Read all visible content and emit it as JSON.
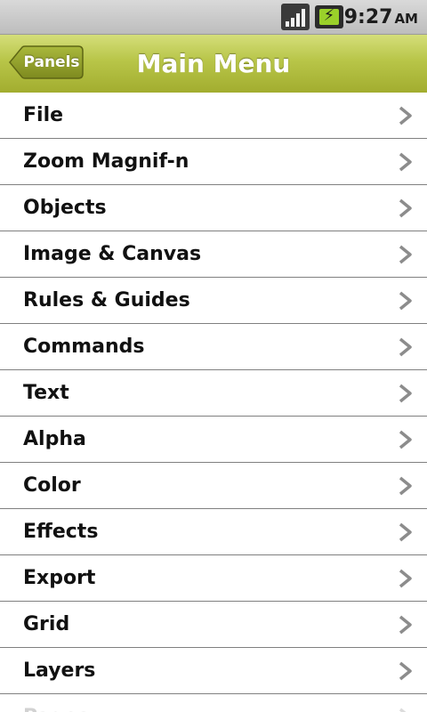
{
  "status_bar": {
    "time": "9:27",
    "ampm": "AM",
    "icons": [
      "signal-icon",
      "battery-charging-icon"
    ]
  },
  "title_bar": {
    "back_label": "Panels",
    "title": "Main Menu",
    "accent_color": "#b8c548"
  },
  "menu": {
    "items": [
      {
        "label": "File"
      },
      {
        "label": "Zoom Magnif-n"
      },
      {
        "label": "Objects"
      },
      {
        "label": "Image & Canvas"
      },
      {
        "label": "Rules & Guides"
      },
      {
        "label": "Commands"
      },
      {
        "label": "Text"
      },
      {
        "label": "Alpha"
      },
      {
        "label": "Color"
      },
      {
        "label": "Effects"
      },
      {
        "label": "Export"
      },
      {
        "label": "Grid"
      },
      {
        "label": "Layers"
      },
      {
        "label": "Pages"
      }
    ]
  }
}
